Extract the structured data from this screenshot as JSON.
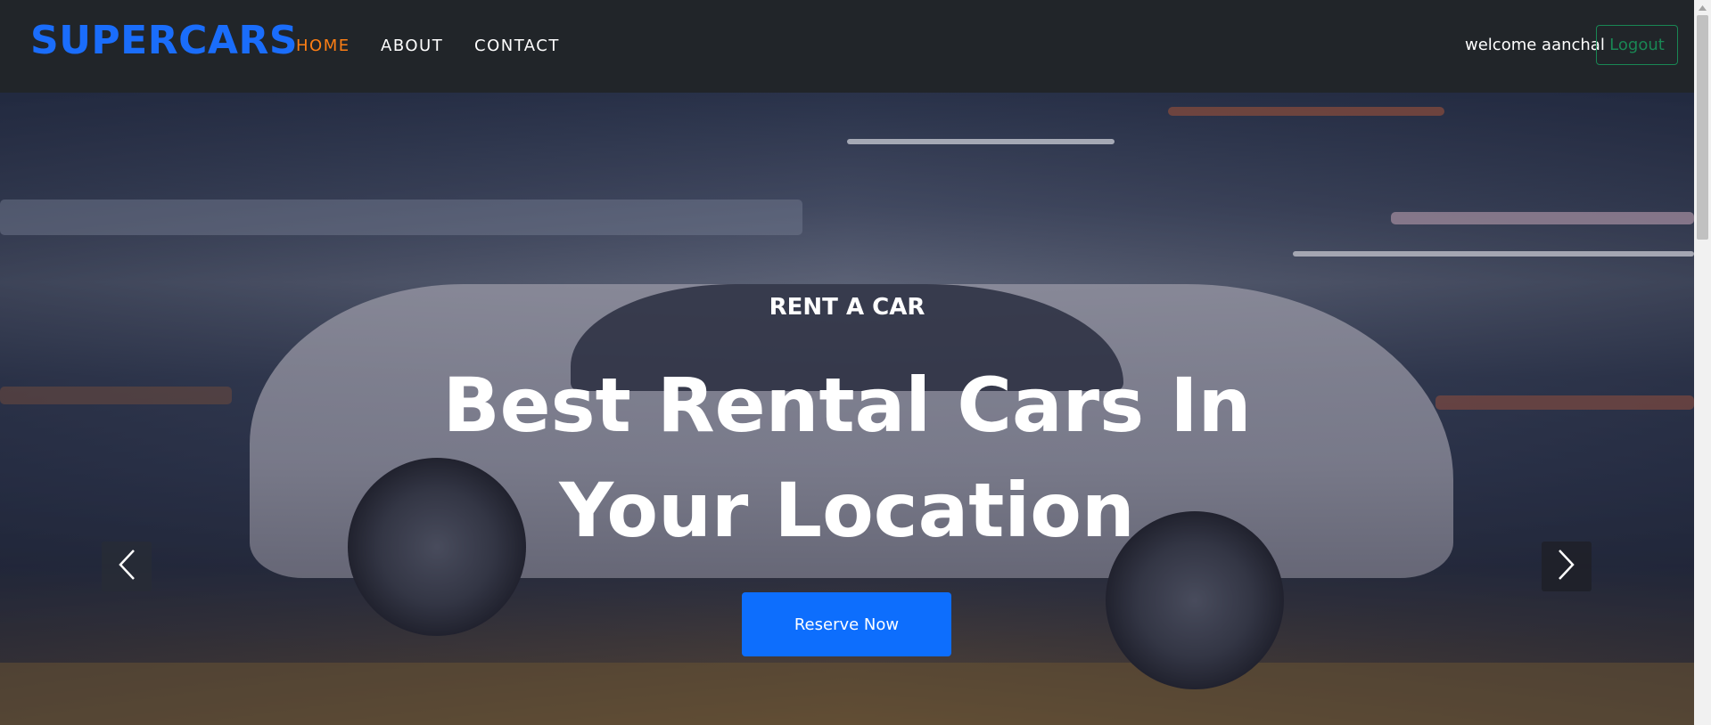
{
  "navbar": {
    "brand": "SUPERCARS",
    "links": [
      "HOME",
      "ABOUT",
      "CONTACT"
    ],
    "active_link": "HOME",
    "welcome_text": "welcome aanchal",
    "logout_label": "Logout"
  },
  "hero": {
    "kicker": "RENT A CAR",
    "headline": "Best Rental Cars In Your Location",
    "cta_label": "Reserve Now",
    "prev_icon": "chevron-left-icon",
    "next_icon": "chevron-right-icon"
  },
  "colors": {
    "brand": "#1a6dfb",
    "nav_bg": "#212529",
    "active_link": "#fd7e14",
    "logout_outline": "#198754",
    "cta": "#0d6efd"
  }
}
